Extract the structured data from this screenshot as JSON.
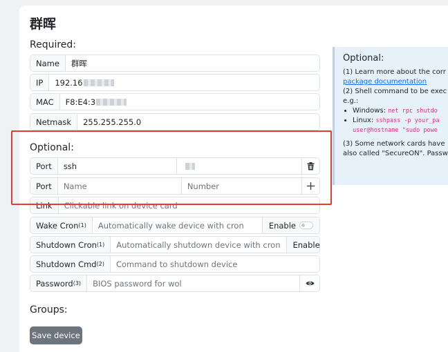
{
  "page": {
    "title": "群晖"
  },
  "required": {
    "heading": "Required:",
    "name_label": "Name",
    "name_value": "群晖",
    "ip_label": "IP",
    "ip_value": "192.16",
    "mac_label": "MAC",
    "mac_value": "F8:E4:3",
    "netmask_label": "Netmask",
    "netmask_value": "255.255.255.0"
  },
  "optional": {
    "heading": "Optional:",
    "port1_label": "Port",
    "port1_name": "ssh",
    "port2_label": "Port",
    "port2_name_placeholder": "Name",
    "port2_number_placeholder": "Number",
    "link_label": "Link",
    "link_placeholder": "Clickable link on device card",
    "wake_cron_label": "Wake Cron",
    "wake_cron_sup": "(1)",
    "wake_cron_placeholder": "Automatically wake device with cron",
    "wake_cron_toggle": "Enable",
    "shutdown_cron_label": "Shutdown Cron",
    "shutdown_cron_sup": "(1)",
    "shutdown_cron_placeholder": "Automatically shutdown device with cron",
    "shutdown_cron_toggle": "Enable",
    "shutdown_cmd_label": "Shutdown Cmd",
    "shutdown_cmd_sup": "(2)",
    "shutdown_cmd_placeholder": "Command to shutdown device",
    "password_label": "Password",
    "password_sup": "(3)",
    "password_placeholder": "BIOS password for wol"
  },
  "groups": {
    "heading": "Groups:"
  },
  "actions": {
    "save_label": "Save device"
  },
  "sidebar": {
    "heading": "Optional:",
    "line1": "(1) Learn more about the corr",
    "link": "package documentation",
    "line2": "(2) Shell command to be exec",
    "eg": "e.g.:",
    "windows_label": "Windows: ",
    "windows_code": "net rpc shutdo",
    "linux_label": "Linux: ",
    "linux_code": "sshpass -p your_pa",
    "linux_code2": "user@hostname \"sudo powe",
    "line3": "(3) Some network cards have",
    "line4": "also called \"SecureON\". Passw"
  },
  "icons": {
    "trash": "trash-icon",
    "plus": "plus-icon",
    "eye": "eye-icon"
  },
  "colors": {
    "highlight": "#e53935",
    "button": "#6c757d",
    "info_bg": "#e7f1fa"
  }
}
